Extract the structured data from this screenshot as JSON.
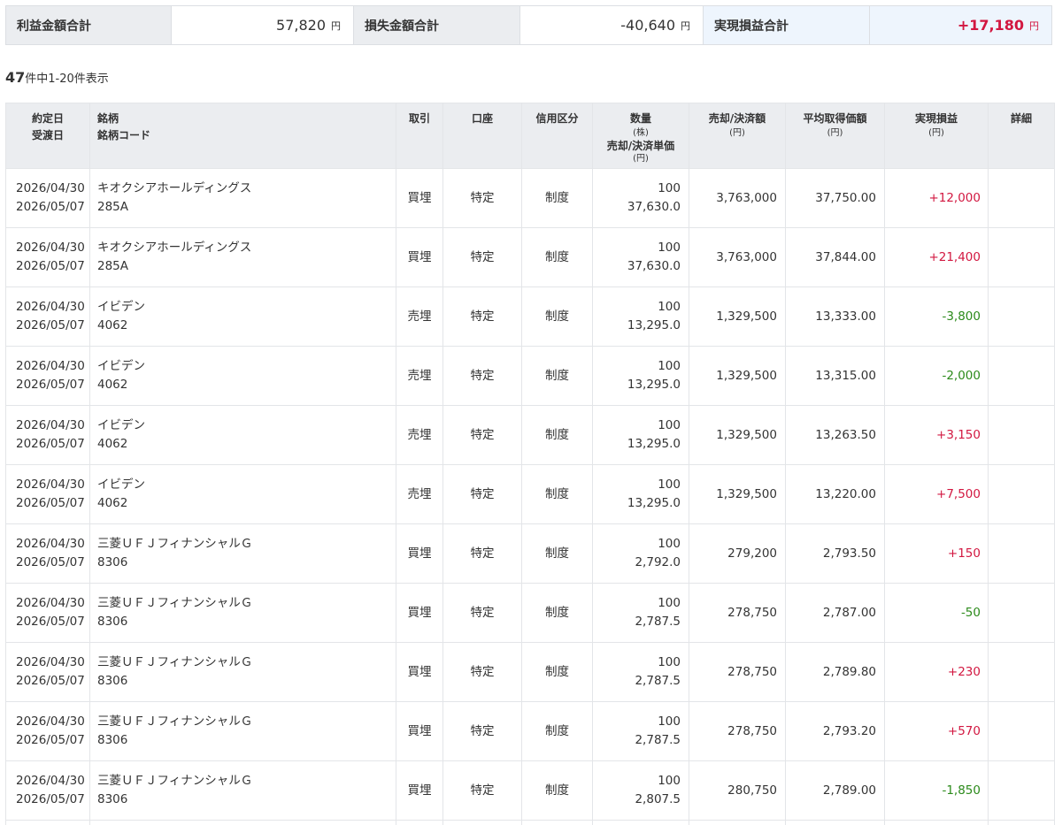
{
  "summary": {
    "profit_label": "利益金額合計",
    "profit_value": "57,820",
    "loss_label": "損失金額合計",
    "loss_value": "-40,640",
    "realized_label": "実現損益合計",
    "realized_value": "+17,180",
    "unit": "円"
  },
  "count": {
    "total": "47",
    "text": "件中1-20件表示"
  },
  "headers": {
    "date_trade": "約定日",
    "date_settle": "受渡日",
    "stock_name": "銘柄",
    "stock_code": "銘柄コード",
    "trade": "取引",
    "account": "口座",
    "credit": "信用区分",
    "qty": "数量",
    "qty_unit": "(株)",
    "unit_price": "売却/決済単価",
    "unit_price_unit": "(円)",
    "amount": "売却/決済額",
    "amount_unit": "(円)",
    "avg_cost": "平均取得価額",
    "avg_cost_unit": "(円)",
    "pl": "実現損益",
    "pl_unit": "(円)",
    "detail": "詳細"
  },
  "rows": [
    {
      "trade_date": "2026/04/30",
      "settle_date": "2026/05/07",
      "name": "キオクシアホールディングス",
      "code": "285A",
      "trade": "買埋",
      "account": "特定",
      "credit": "制度",
      "qty": "100",
      "price": "37,630.0",
      "amount": "3,763,000",
      "avg": "37,750.00",
      "pl": "+12,000",
      "sign": "pos"
    },
    {
      "trade_date": "2026/04/30",
      "settle_date": "2026/05/07",
      "name": "キオクシアホールディングス",
      "code": "285A",
      "trade": "買埋",
      "account": "特定",
      "credit": "制度",
      "qty": "100",
      "price": "37,630.0",
      "amount": "3,763,000",
      "avg": "37,844.00",
      "pl": "+21,400",
      "sign": "pos"
    },
    {
      "trade_date": "2026/04/30",
      "settle_date": "2026/05/07",
      "name": "イビデン",
      "code": "4062",
      "trade": "売埋",
      "account": "特定",
      "credit": "制度",
      "qty": "100",
      "price": "13,295.0",
      "amount": "1,329,500",
      "avg": "13,333.00",
      "pl": "-3,800",
      "sign": "neg"
    },
    {
      "trade_date": "2026/04/30",
      "settle_date": "2026/05/07",
      "name": "イビデン",
      "code": "4062",
      "trade": "売埋",
      "account": "特定",
      "credit": "制度",
      "qty": "100",
      "price": "13,295.0",
      "amount": "1,329,500",
      "avg": "13,315.00",
      "pl": "-2,000",
      "sign": "neg"
    },
    {
      "trade_date": "2026/04/30",
      "settle_date": "2026/05/07",
      "name": "イビデン",
      "code": "4062",
      "trade": "売埋",
      "account": "特定",
      "credit": "制度",
      "qty": "100",
      "price": "13,295.0",
      "amount": "1,329,500",
      "avg": "13,263.50",
      "pl": "+3,150",
      "sign": "pos"
    },
    {
      "trade_date": "2026/04/30",
      "settle_date": "2026/05/07",
      "name": "イビデン",
      "code": "4062",
      "trade": "売埋",
      "account": "特定",
      "credit": "制度",
      "qty": "100",
      "price": "13,295.0",
      "amount": "1,329,500",
      "avg": "13,220.00",
      "pl": "+7,500",
      "sign": "pos"
    },
    {
      "trade_date": "2026/04/30",
      "settle_date": "2026/05/07",
      "name": "三菱ＵＦＪフィナンシャルＧ",
      "code": "8306",
      "trade": "買埋",
      "account": "特定",
      "credit": "制度",
      "qty": "100",
      "price": "2,792.0",
      "amount": "279,200",
      "avg": "2,793.50",
      "pl": "+150",
      "sign": "pos"
    },
    {
      "trade_date": "2026/04/30",
      "settle_date": "2026/05/07",
      "name": "三菱ＵＦＪフィナンシャルＧ",
      "code": "8306",
      "trade": "買埋",
      "account": "特定",
      "credit": "制度",
      "qty": "100",
      "price": "2,787.5",
      "amount": "278,750",
      "avg": "2,787.00",
      "pl": "-50",
      "sign": "neg"
    },
    {
      "trade_date": "2026/04/30",
      "settle_date": "2026/05/07",
      "name": "三菱ＵＦＪフィナンシャルＧ",
      "code": "8306",
      "trade": "買埋",
      "account": "特定",
      "credit": "制度",
      "qty": "100",
      "price": "2,787.5",
      "amount": "278,750",
      "avg": "2,789.80",
      "pl": "+230",
      "sign": "pos"
    },
    {
      "trade_date": "2026/04/30",
      "settle_date": "2026/05/07",
      "name": "三菱ＵＦＪフィナンシャルＧ",
      "code": "8306",
      "trade": "買埋",
      "account": "特定",
      "credit": "制度",
      "qty": "100",
      "price": "2,787.5",
      "amount": "278,750",
      "avg": "2,793.20",
      "pl": "+570",
      "sign": "pos"
    },
    {
      "trade_date": "2026/04/30",
      "settle_date": "2026/05/07",
      "name": "三菱ＵＦＪフィナンシャルＧ",
      "code": "8306",
      "trade": "買埋",
      "account": "特定",
      "credit": "制度",
      "qty": "100",
      "price": "2,807.5",
      "amount": "280,750",
      "avg": "2,789.00",
      "pl": "-1,850",
      "sign": "neg"
    }
  ],
  "colors": {
    "positive": "#d21740",
    "negative": "#2b8a1a",
    "header_bg": "#ebedf0",
    "realized_bg": "#eef5fd"
  }
}
